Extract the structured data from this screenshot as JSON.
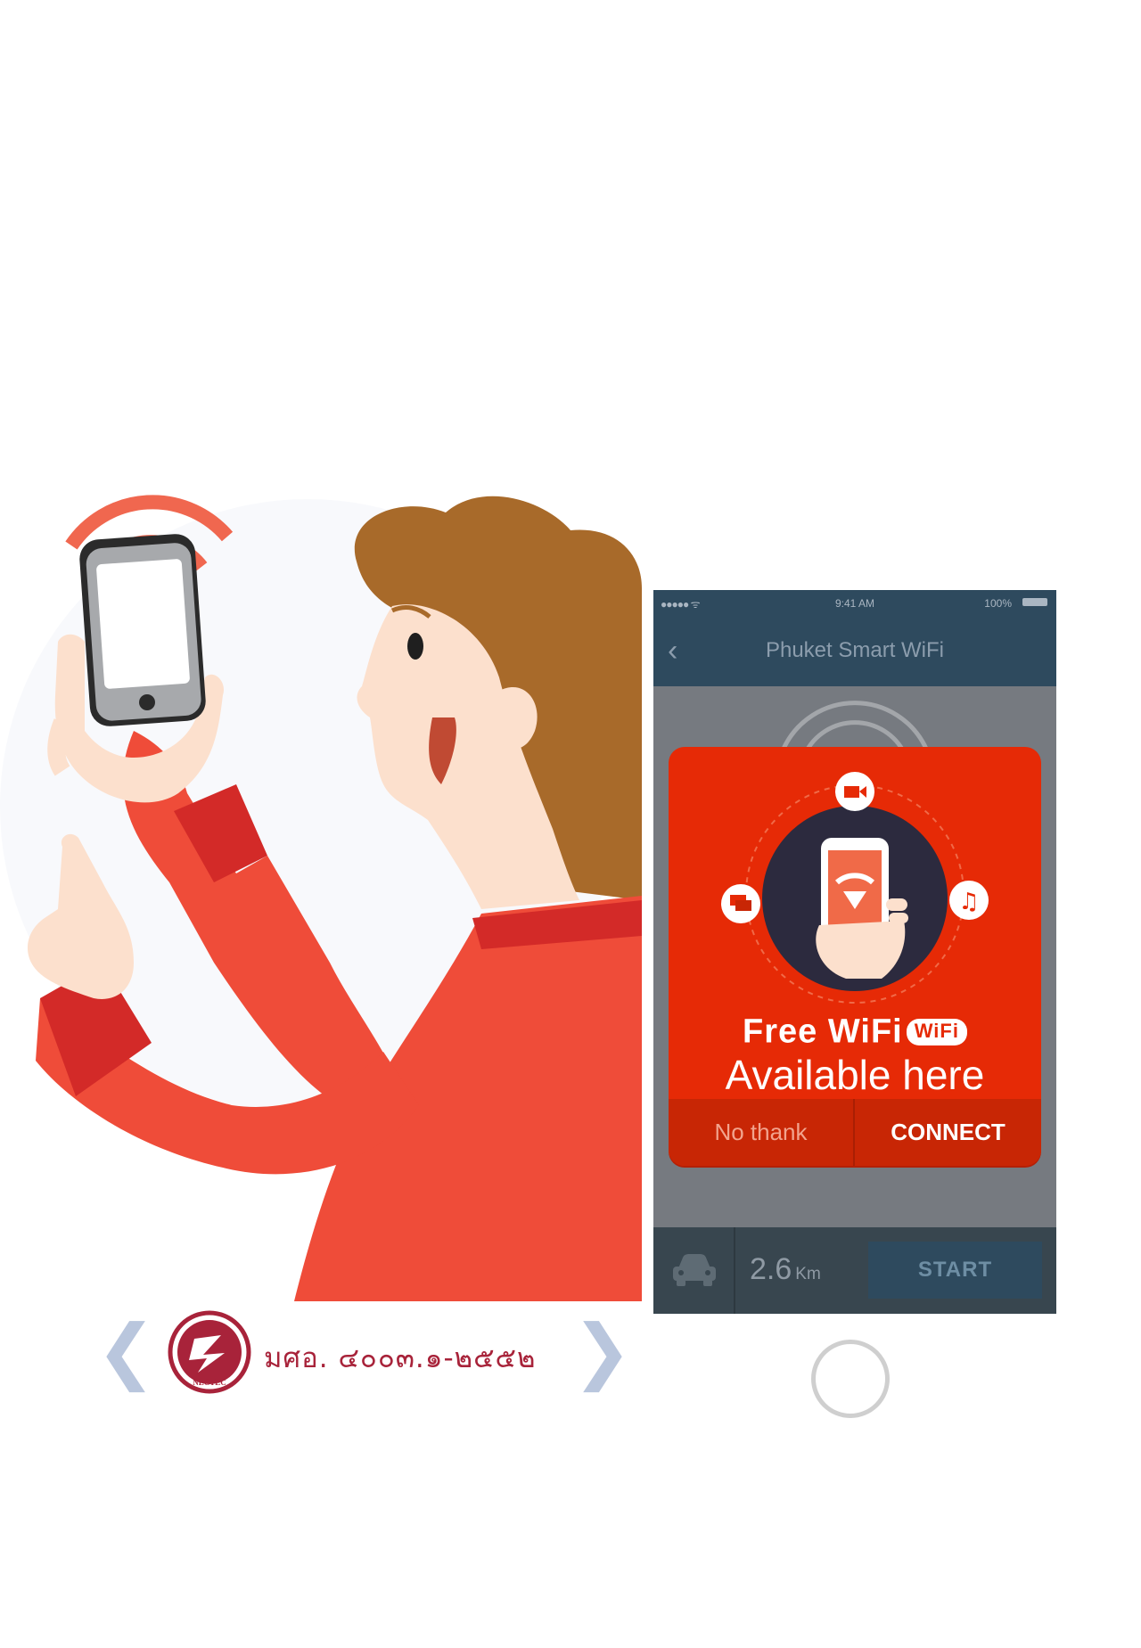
{
  "phone": {
    "status": {
      "signal": "●●●●● ᯤ",
      "time": "9:41 AM",
      "battery": "100%"
    },
    "nav": {
      "back_label": "‹",
      "title": "Phuket Smart WiFi"
    },
    "dialog": {
      "title": "Free WiFi",
      "badge": "WiFi",
      "subtitle": "Available here",
      "decline_label": "No thank",
      "connect_label": "CONNECT"
    },
    "bottom_bar": {
      "distance_value": "2.6",
      "distance_unit": "Km",
      "start_label": "START"
    }
  },
  "certification": {
    "logo_text": "NECTEC",
    "standard_text": "มศอ. ๔๐๐๓.๑-๒๕๕๒",
    "prev_label": "❮",
    "next_label": "❯"
  },
  "colors": {
    "accent_red": "#e62a06",
    "nav_blue": "#2e4a5e",
    "wifi_orange": "#f0674f",
    "shirt_red": "#ef4c39"
  },
  "icons": [
    "wifi-signal-icon",
    "back-chevron-icon",
    "video-camera-icon",
    "chat-icon",
    "music-note-icon",
    "car-icon"
  ]
}
